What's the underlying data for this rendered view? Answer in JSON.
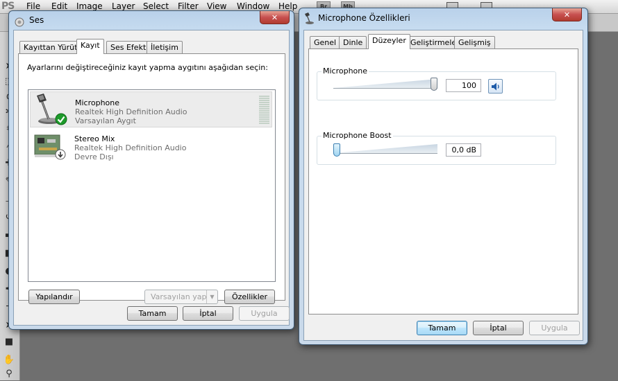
{
  "photoshop": {
    "logo": "PS",
    "menu": [
      "File",
      "Edit",
      "Image",
      "Layer",
      "Select",
      "Filter",
      "View",
      "Window",
      "Help"
    ],
    "badges": [
      "Br",
      "Mb"
    ]
  },
  "ses_window": {
    "title": "Ses",
    "close_glyph": "✕",
    "tabs": [
      "Kayıttan Yürüt",
      "Kayıt",
      "Ses Efekti",
      "İletişim"
    ],
    "active_tab": "Kayıt",
    "instruction": "Ayarlarını değiştireceğiniz kayıt yapma aygıtını aşağıdan seçin:",
    "devices": [
      {
        "name": "Microphone",
        "driver": "Realtek High Definition Audio",
        "status": "Varsayılan Aygıt",
        "selected": true
      },
      {
        "name": "Stereo Mix",
        "driver": "Realtek High Definition Audio",
        "status": "Devre Dışı",
        "selected": false
      }
    ],
    "buttons": {
      "configure": "Yapılandır",
      "set_default": "Varsayılan yap",
      "properties": "Özellikler",
      "ok": "Tamam",
      "cancel": "İptal",
      "apply": "Uygula"
    }
  },
  "mic_window": {
    "title": "Microphone Özellikleri",
    "close_glyph": "✕",
    "tabs": [
      "Genel",
      "Dinle",
      "Düzeyler",
      "Geliştirmeler",
      "Gelişmiş"
    ],
    "active_tab": "Düzeyler",
    "microphone": {
      "label": "Microphone",
      "value": "100",
      "level": 1.0
    },
    "boost": {
      "label": "Microphone Boost",
      "value": "0,0 dB",
      "level": 0.0
    },
    "buttons": {
      "ok": "Tamam",
      "cancel": "İptal",
      "apply": "Uygula"
    }
  },
  "colors": {
    "accent": "#3c7fb1",
    "close": "#c75050",
    "success": "#1e9b2b"
  }
}
